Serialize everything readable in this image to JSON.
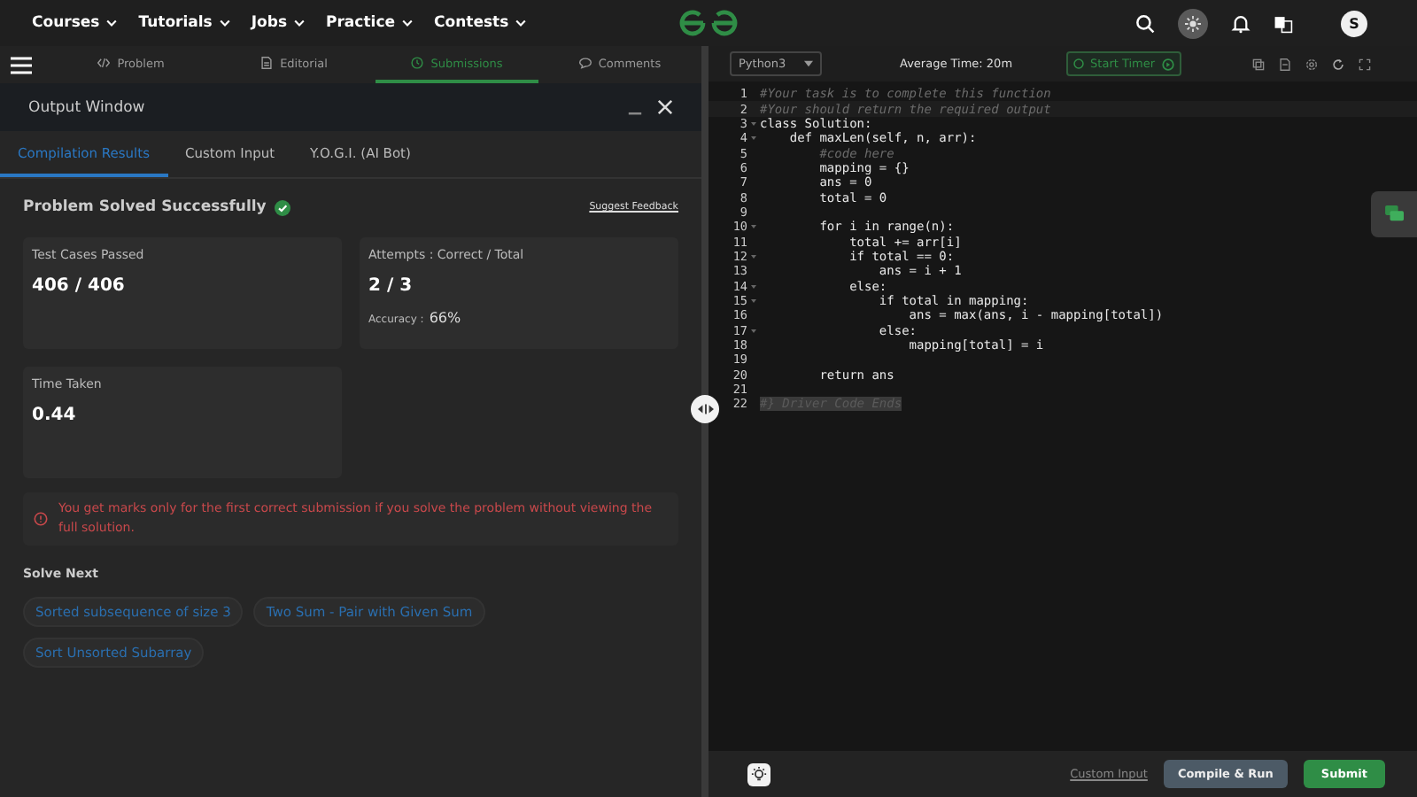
{
  "nav": {
    "items": [
      {
        "label": "Courses"
      },
      {
        "label": "Tutorials"
      },
      {
        "label": "Jobs"
      },
      {
        "label": "Practice"
      },
      {
        "label": "Contests"
      }
    ],
    "avatar": "S"
  },
  "problem_tabs": [
    {
      "label": "Problem",
      "selected": false
    },
    {
      "label": "Editorial",
      "selected": false
    },
    {
      "label": "Submissions",
      "selected": true
    },
    {
      "label": "Comments",
      "selected": false
    }
  ],
  "output_window": {
    "title": "Output Window",
    "tabs": [
      {
        "label": "Compilation Results",
        "selected": true
      },
      {
        "label": "Custom Input",
        "selected": false
      },
      {
        "label": "Y.O.G.I. (AI Bot)",
        "selected": false
      }
    ],
    "status": "Problem Solved Successfully",
    "feedback_link": "Suggest Feedback",
    "stats": [
      {
        "label": "Test Cases Passed",
        "value": "406 / 406"
      },
      {
        "label": "Attempts : Correct / Total",
        "value": "2 / 3",
        "sub_label": "Accuracy :",
        "sub_value": "66%"
      },
      {
        "label": "Time Taken",
        "value": "0.44"
      }
    ],
    "notice": "You get marks only for the first correct submission if you solve the problem without viewing the full solution.",
    "solve_next": {
      "title": "Solve Next",
      "items": [
        "Sorted subsequence of size 3",
        "Two Sum - Pair with Given Sum",
        "Sort Unsorted Subarray"
      ]
    }
  },
  "editor": {
    "language": "Python3",
    "average_time": "Average Time: 20m",
    "timer_button": "Start Timer",
    "lines": [
      {
        "no": "1",
        "text": "#Your task is to complete this function",
        "kind": "comment",
        "foldable": false
      },
      {
        "no": "2",
        "text": "#Your should return the required output",
        "kind": "comment",
        "foldable": false
      },
      {
        "no": "3",
        "text": "class Solution:",
        "kind": "code",
        "foldable": true
      },
      {
        "no": "4",
        "text": "    def maxLen(self, n, arr):",
        "kind": "code",
        "foldable": true
      },
      {
        "no": "5",
        "text": "        #code here",
        "kind": "comment",
        "foldable": false
      },
      {
        "no": "6",
        "text": "        mapping = {}",
        "kind": "code",
        "foldable": false
      },
      {
        "no": "7",
        "text": "        ans = 0",
        "kind": "code",
        "foldable": false
      },
      {
        "no": "8",
        "text": "        total = 0",
        "kind": "code",
        "foldable": false
      },
      {
        "no": "9",
        "foldable": false
      },
      {
        "no": "10",
        "text": "        for i in range(n):",
        "kind": "code",
        "foldable": true
      },
      {
        "no": "11",
        "text": "            total += arr[i]",
        "kind": "code",
        "foldable": false
      },
      {
        "no": "12",
        "text": "            if total == 0:",
        "kind": "code",
        "foldable": true
      },
      {
        "no": "13",
        "text": "                ans = i + 1",
        "kind": "code",
        "foldable": false
      },
      {
        "no": "14",
        "text": "            else:",
        "kind": "code",
        "foldable": true
      },
      {
        "no": "15",
        "text": "                if total in mapping:",
        "kind": "code",
        "foldable": true
      },
      {
        "no": "16",
        "text": "                    ans = max(ans, i - mapping[total])",
        "kind": "code",
        "foldable": false
      },
      {
        "no": "17",
        "text": "                else:",
        "kind": "code",
        "foldable": true
      },
      {
        "no": "18",
        "text": "                    mapping[total] = i",
        "kind": "code",
        "foldable": false
      },
      {
        "no": "19",
        "foldable": false
      },
      {
        "no": "20",
        "text": "        return ans",
        "kind": "code",
        "foldable": false
      },
      {
        "no": "21",
        "foldable": false
      },
      {
        "no": "22",
        "text": "#} Driver Code Ends",
        "kind": "folded",
        "foldable": false
      }
    ],
    "custom_input_link": "Custom Input",
    "compile_button": "Compile & Run",
    "submit_button": "Submit"
  }
}
